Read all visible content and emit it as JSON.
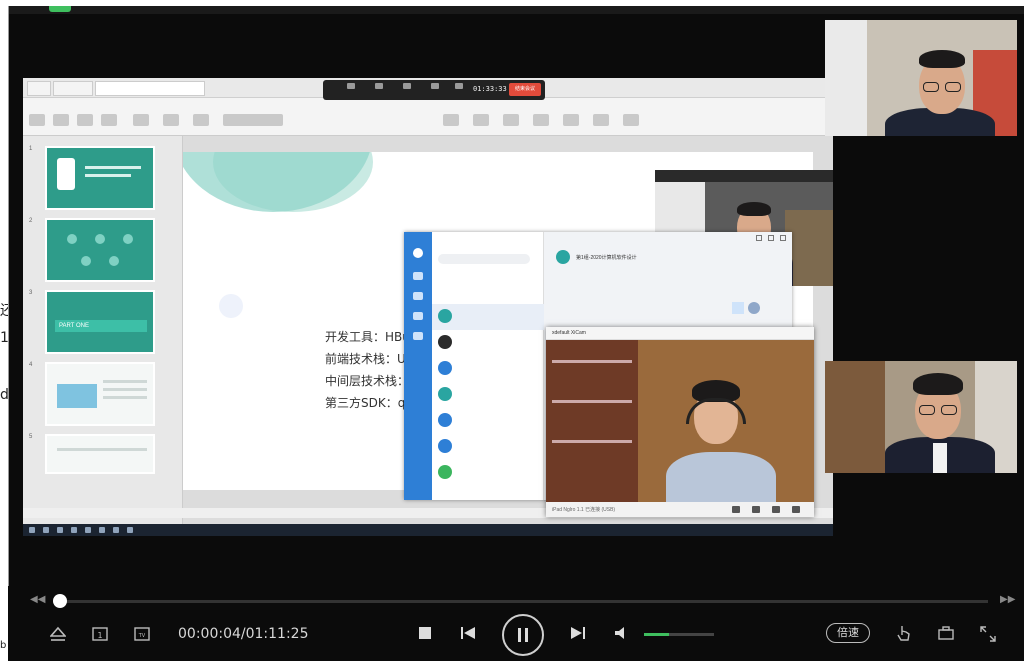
{
  "side_fragments": [
    "还",
    "1",
    "da",
    "b"
  ],
  "meeting": {
    "timer": "01:33:33",
    "end_label": "结束会议"
  },
  "slides": {
    "part_label": "PART ONE",
    "lines": [
      "开发工具：HBuilderX",
      "前端技术栈：Uni-app",
      "中间层技术栈：Expre",
      "第三方SDK：qqjssdk"
    ]
  },
  "chat": {
    "header_title": "第1组-2020计算机软件设计"
  },
  "cam_window": {
    "title": "xdefault XiCam",
    "footer": "iPad Nglro 1.1 已连接 (USB)"
  },
  "player": {
    "time": "00:00:04/01:11:25",
    "speed_label": "倍速",
    "progress": 0.001,
    "volume": 0.35
  },
  "colors": {
    "accent": "#3fbf5f",
    "slide_teal": "#2e9c8a",
    "chat_blue": "#2e7fd6",
    "end_red": "#e24b3b"
  }
}
